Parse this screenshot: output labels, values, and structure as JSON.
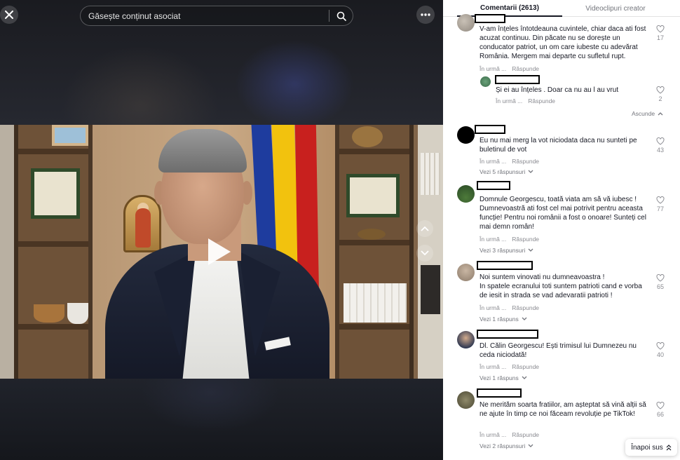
{
  "search": {
    "placeholder": "Găsește conținut asociat"
  },
  "tabs": {
    "comments": "Comentarii (2613)",
    "videos": "Videoclipuri creator"
  },
  "meta_labels": {
    "time": "În urmă ...",
    "reply": "Răspunde"
  },
  "comments": [
    {
      "text": "V-am înțeles întotdeauna cuvintele, chiar daca ati fost acuzat continuu. Din păcate nu se dorește un conducator patriot, un om care iubeste cu adevărat România. Mergem mai departe cu sufletul rupt.",
      "likes": "17"
    },
    {
      "text": "Și ei au înțeles . Doar ca nu au l au vrut",
      "likes": "2"
    },
    {
      "text": "Eu nu mai merg la vot niciodata daca nu sunteti pe buletinul de vot",
      "likes": "43",
      "replies": "Vezi 5 răspunsuri"
    },
    {
      "text": "Domnule Georgescu, toată viata am să vă iubesc ! Dumnevoastră ati fost cel mai potrivit pentru aceasta funcție! Pentru noi românii a fost o onoare! Sunteți cel mai demn român!",
      "likes": "77",
      "replies": "Vezi 3 răspunsuri"
    },
    {
      "text": "Noi suntem vinovati nu dumneavoastra !\nIn spatele ecranului toti suntem patrioti cand e vorba de iesit in strada se vad adevaratii patrioti !",
      "likes": "65",
      "replies": "Vezi 1 răspuns"
    },
    {
      "text": "Dl. Călin Georgescu! Ești trimisul lui Dumnezeu nu ceda niciodată!",
      "likes": "40",
      "replies": "Vezi 1 răspuns"
    },
    {
      "text": "Ne merităm soarta fratiilor, am așteptat să vină alții să ne ajute în timp ce noi făceam revoluție pe TikTok!",
      "likes": "66",
      "replies": "Vezi 2 răspunsuri"
    }
  ],
  "collapse_label": "Ascunde",
  "back_to_top": "Înapoi sus",
  "colors": {
    "accent": "#161823",
    "muted": "#8a8b91",
    "divider": "#e3e3e3"
  }
}
